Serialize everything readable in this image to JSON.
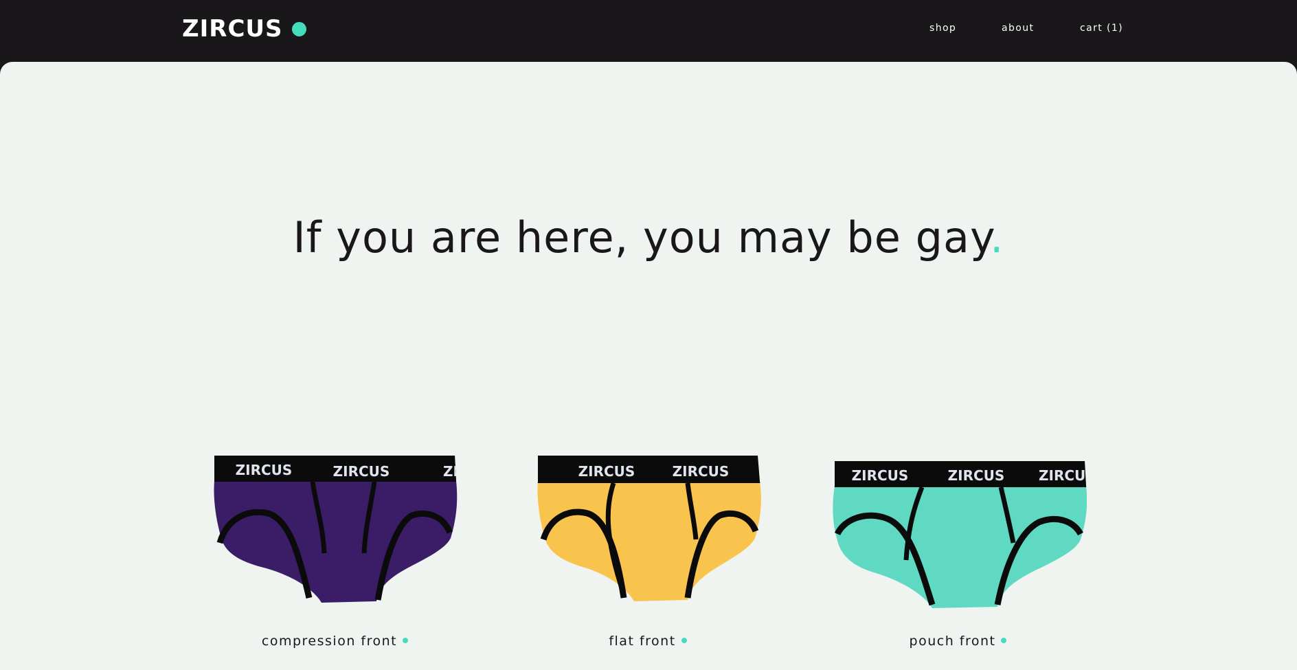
{
  "header": {
    "logo_text": "ZIRCUS",
    "nav": {
      "shop": "shop",
      "about": "about",
      "cart": "cart (1)"
    }
  },
  "hero": {
    "headline": "If you are here, you may be gay",
    "headline_punct": "."
  },
  "products": [
    {
      "label": "compression front",
      "color": "#3a1d66",
      "waistband_text": "ZIRCUS"
    },
    {
      "label": "flat front",
      "color": "#f8c44d",
      "waistband_text": "ZIRCUS"
    },
    {
      "label": "pouch front",
      "color": "#5fd9c2",
      "waistband_text": "ZIRCUS"
    }
  ],
  "colors": {
    "accent": "#45dcbd",
    "dark": "#19171a",
    "background": "#f0f4f1"
  }
}
